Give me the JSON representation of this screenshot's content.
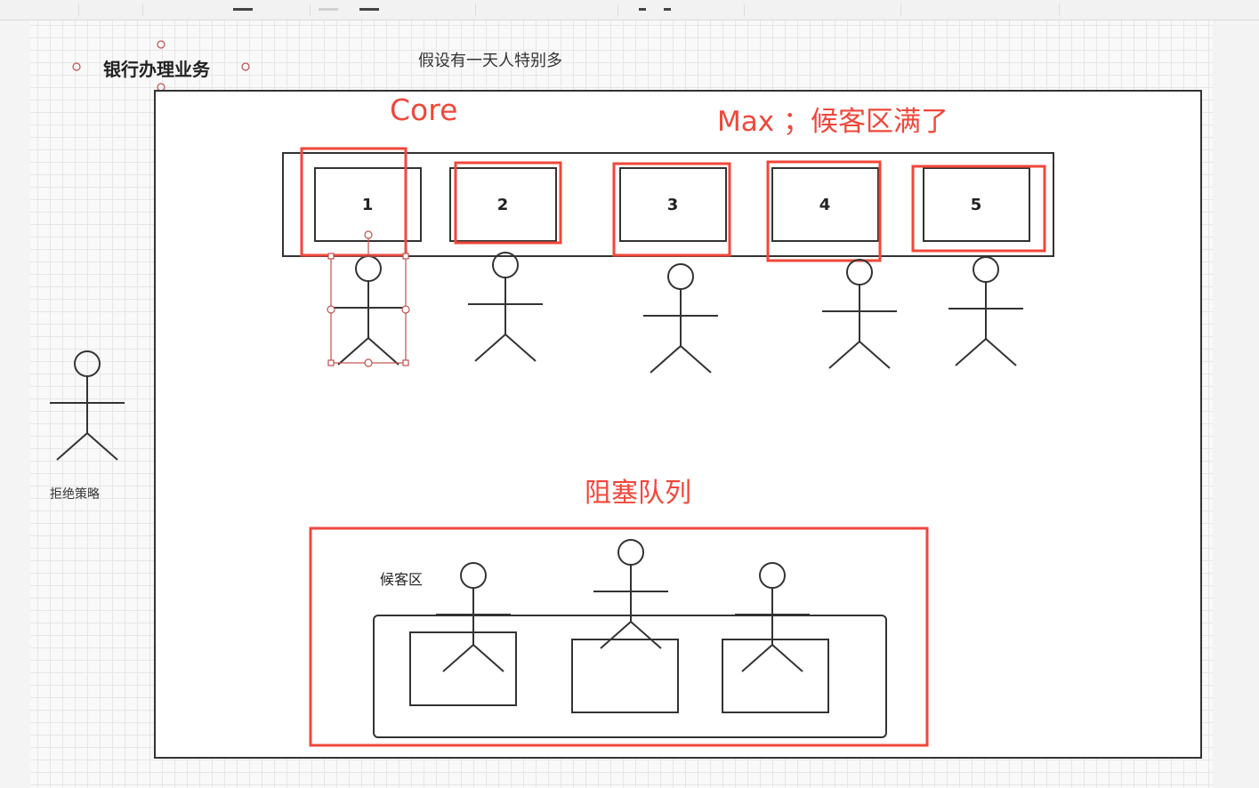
{
  "title": "银行办理业务",
  "note": "假设有一天人特别多",
  "core_label": "Core",
  "max_label": "Max ；候客区满了",
  "queue_label": "阻塞队列",
  "waiting_area_label": "候客区",
  "reject_label": "拒绝策略",
  "windows": [
    "1",
    "2",
    "3",
    "4",
    "5"
  ],
  "colors": {
    "highlight": "#f0473a",
    "stroke": "#333333",
    "selection": "#c0504d"
  },
  "icons": [
    "stick-figure-icon"
  ]
}
